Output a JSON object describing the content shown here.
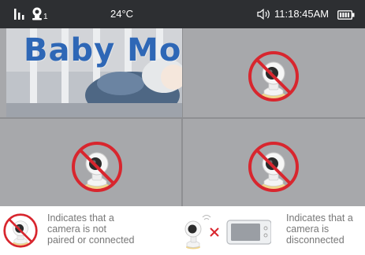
{
  "status_bar": {
    "signal_icon": "signal-bars-icon",
    "camera_icon": "camera-icon",
    "camera_number": "1",
    "temperature": "24°C",
    "volume_icon": "speaker-icon",
    "time": "11:18:45AM",
    "battery_icon": "battery-icon"
  },
  "feed": {
    "title": "Baby Monit"
  },
  "slots": [
    {
      "state": "not-paired"
    },
    {
      "state": "not-paired"
    },
    {
      "state": "not-paired"
    }
  ],
  "legend": {
    "not_paired_text": "Indicates that a\ncamera is not\npaired or connected",
    "disconnected_text": "Indicates that  a\ncamera is\ndisconnected"
  },
  "colors": {
    "screen_bg": "#a7a8ab",
    "status_bar_bg": "#2d2f32",
    "prohibit_red": "#d8262e",
    "legend_text": "#777777"
  }
}
